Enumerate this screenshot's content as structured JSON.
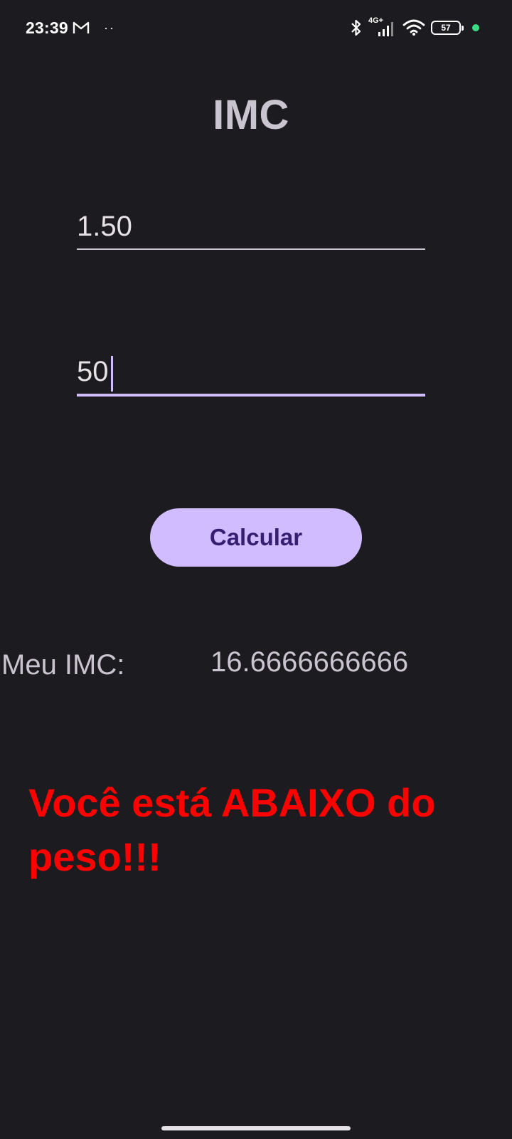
{
  "status_bar": {
    "time": "23:39",
    "notification_dots": "··",
    "network": "4G+",
    "battery": "57",
    "icons": [
      "gmail-icon",
      "bluetooth-icon",
      "signal-icon",
      "wifi-icon",
      "battery-icon"
    ],
    "privacy_dot_color": "#3ddc84"
  },
  "app": {
    "title": "IMC",
    "height_input": {
      "value": "1.50"
    },
    "weight_input": {
      "value": "50"
    },
    "calculate_button": "Calcular",
    "result_label": "Meu IMC:",
    "result_value": "16.6666666666",
    "result_message": "Você está ABAIXO do peso!!!"
  },
  "colors": {
    "background": "#1c1b1f",
    "accent": "#d0bcff",
    "button_text": "#381e72",
    "message": "#ff0000"
  }
}
